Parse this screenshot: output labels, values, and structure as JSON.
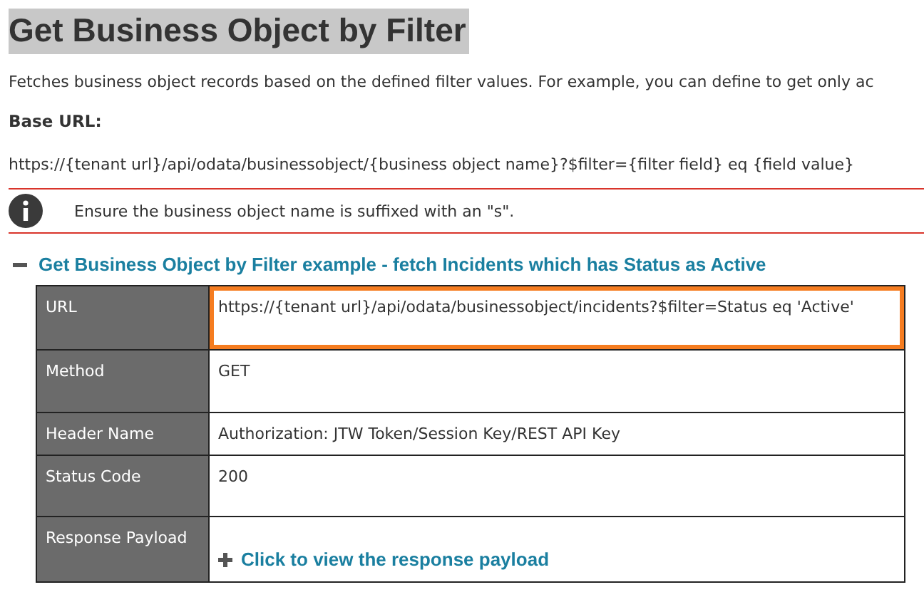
{
  "title": "Get Business Object by Filter",
  "description": "Fetches business object records based on the defined filter values. For example, you can define to get only ac",
  "base_url_label": "Base URL:",
  "base_url": "https://{tenant url}/api/odata/businessobject/{business object name}?$filter={filter field} eq {field value}",
  "note": "Ensure the business object name is suffixed with an \"s\".",
  "example": {
    "title": "Get Business Object by Filter example - fetch Incidents which has Status as Active",
    "expanded": true,
    "rows": [
      {
        "label": "URL",
        "kind": "text",
        "value": "https://{tenant url}/api/odata/businessobject/incidents?$filter=Status eq 'Active'",
        "highlighted": true
      },
      {
        "label": "Method",
        "kind": "text",
        "value": "GET",
        "highlighted": false
      },
      {
        "label": "Header Name",
        "kind": "text",
        "value": "Authorization: JTW Token/Session Key/REST API Key",
        "highlighted": false
      },
      {
        "label": "Status Code",
        "kind": "text",
        "value": "200",
        "highlighted": false
      },
      {
        "label": "Response Payload",
        "kind": "link",
        "value": "Click to view the response payload",
        "highlighted": false
      }
    ]
  }
}
